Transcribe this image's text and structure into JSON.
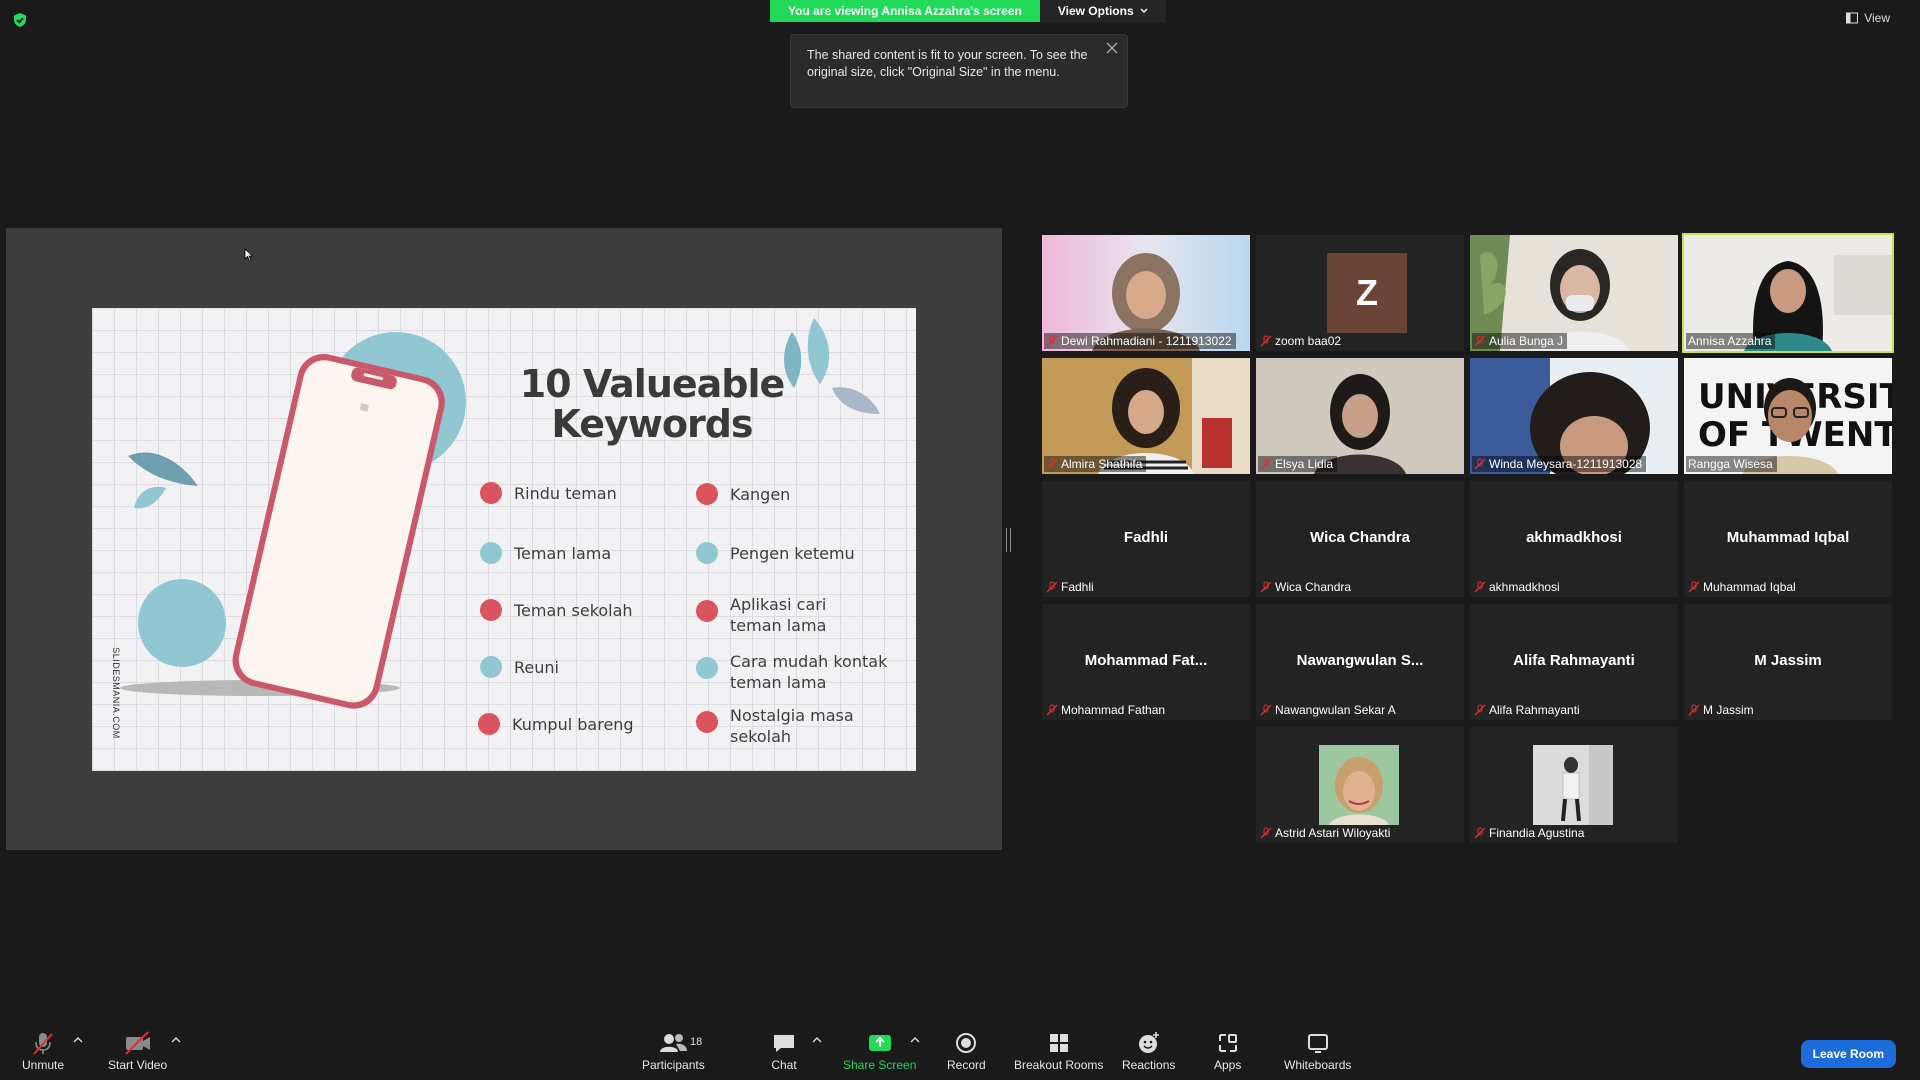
{
  "top": {
    "viewing_banner": "You are viewing Annisa Azzahra's screen",
    "view_options": "View Options",
    "tooltip_text": "The shared content is fit to your screen. To see the original size, click \"Original Size\" in the menu.",
    "view_label": "View"
  },
  "slide": {
    "title_line1": "10 Valueable",
    "title_line2": "Keywords",
    "watermark": "SLIDESMANIA.COM",
    "keywords_left": [
      {
        "text": "Rindu teman",
        "color": "red"
      },
      {
        "text": "Teman lama",
        "color": "blue"
      },
      {
        "text": "Teman sekolah",
        "color": "red"
      },
      {
        "text": "Reuni",
        "color": "blue"
      },
      {
        "text": "Kumpul bareng",
        "color": "red"
      }
    ],
    "keywords_right": [
      {
        "text": "Kangen",
        "color": "red"
      },
      {
        "text": "Pengen ketemu",
        "color": "blue"
      },
      {
        "text": "Aplikasi cari teman lama",
        "color": "red"
      },
      {
        "text": "Cara mudah kontak teman lama",
        "color": "blue"
      },
      {
        "text": "Nostalgia masa sekolah",
        "color": "red"
      }
    ]
  },
  "participants": [
    {
      "name": "Dewi Rahmadiani - 1211913022",
      "type": "video",
      "muted": true
    },
    {
      "name": "zoom baa02",
      "type": "letter",
      "letter": "Z",
      "muted": true
    },
    {
      "name": "Aulia Bunga J",
      "type": "video",
      "muted": true
    },
    {
      "name": "Annisa Azzahra",
      "type": "video",
      "muted": false,
      "active": true
    },
    {
      "name": "Almira Shathifa",
      "type": "video",
      "muted": true
    },
    {
      "name": "Elsya Lidia",
      "type": "video",
      "muted": true
    },
    {
      "name": "Winda Meysara-1211913028",
      "type": "video",
      "muted": true
    },
    {
      "name": "Rangga Wisesa",
      "type": "video",
      "muted": false
    },
    {
      "name": "Fadhli",
      "display": "Fadhli",
      "type": "name",
      "muted": true
    },
    {
      "name": "Wica Chandra",
      "display": "Wica Chandra",
      "type": "name",
      "muted": true
    },
    {
      "name": "akhmadkhosi",
      "display": "akhmadkhosi",
      "type": "name",
      "muted": true
    },
    {
      "name": "Muhammad Iqbal",
      "display": "Muhammad Iqbal",
      "type": "name",
      "muted": true
    },
    {
      "name": "Mohammad Fathan",
      "display": "Mohammad  Fat...",
      "type": "name",
      "muted": true
    },
    {
      "name": "Nawangwulan Sekar A",
      "display": "Nawangwulan  S...",
      "type": "name",
      "muted": true
    },
    {
      "name": "Alifa Rahmayanti",
      "display": "Alifa Rahmayanti",
      "type": "name",
      "muted": true
    },
    {
      "name": "M Jassim",
      "display": "M Jassim",
      "type": "name",
      "muted": true
    },
    {
      "name": "Astrid Astari Wiloyakti",
      "type": "photo",
      "muted": true
    },
    {
      "name": "Finandia Agustina",
      "type": "photo",
      "muted": true
    }
  ],
  "rangga_video_text": "UNIVERSITY OF TWENTE.",
  "toolbar": {
    "unmute": "Unmute",
    "start_video": "Start Video",
    "participants": "Participants",
    "participants_count": "18",
    "chat": "Chat",
    "share_screen": "Share Screen",
    "record": "Record",
    "breakout_rooms": "Breakout Rooms",
    "reactions": "Reactions",
    "apps": "Apps",
    "whiteboards": "Whiteboards",
    "leave": "Leave Room"
  },
  "colors": {
    "banner_green": "#23d959",
    "active_speaker": "#c5e34c",
    "leave_blue": "#1c6cdb",
    "share_green": "#23d959"
  }
}
